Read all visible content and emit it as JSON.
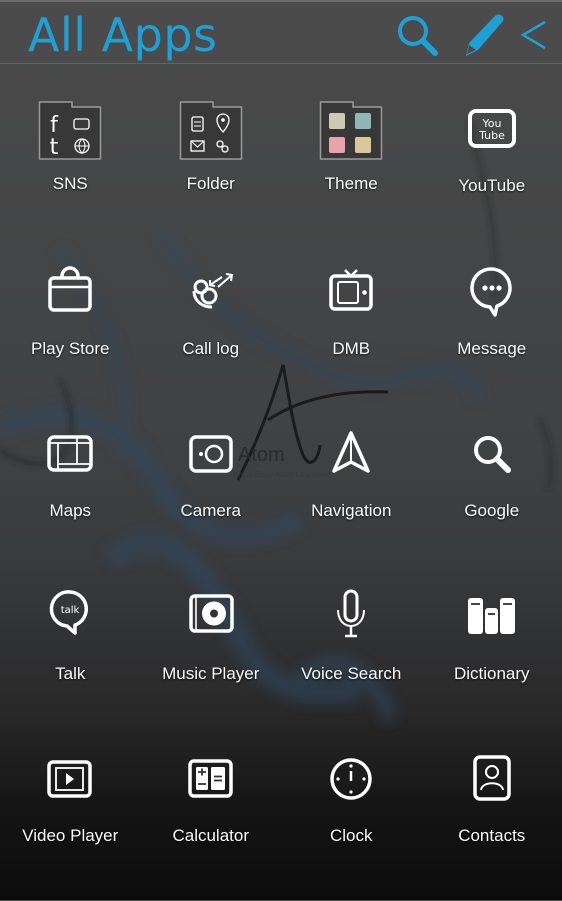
{
  "header": {
    "title": "All Apps",
    "accent_color": "#1ea0d6",
    "actions": [
      {
        "name": "search",
        "icon": "search-icon"
      },
      {
        "name": "edit",
        "icon": "pencil-icon"
      },
      {
        "name": "back",
        "icon": "chevron-left-icon"
      }
    ]
  },
  "watermark": {
    "brand": "Atom",
    "tagline": "Light & Easy Atom Launcher"
  },
  "apps": [
    {
      "label": "SNS",
      "icon": "sns-folder-icon"
    },
    {
      "label": "Folder",
      "icon": "folder-icon"
    },
    {
      "label": "Theme",
      "icon": "theme-folder-icon"
    },
    {
      "label": "YouTube",
      "icon": "youtube-icon"
    },
    {
      "label": "Play Store",
      "icon": "shopping-bag-icon"
    },
    {
      "label": "Call log",
      "icon": "call-log-icon"
    },
    {
      "label": "DMB",
      "icon": "tv-icon"
    },
    {
      "label": "Message",
      "icon": "message-bubble-icon"
    },
    {
      "label": "Maps",
      "icon": "map-grid-icon"
    },
    {
      "label": "Camera",
      "icon": "camera-icon"
    },
    {
      "label": "Navigation",
      "icon": "navigation-arrow-icon"
    },
    {
      "label": "Google",
      "icon": "search-icon"
    },
    {
      "label": "Talk",
      "icon": "talk-bubble-icon"
    },
    {
      "label": "Music Player",
      "icon": "music-disc-icon"
    },
    {
      "label": "Voice Search",
      "icon": "microphone-icon"
    },
    {
      "label": "Dictionary",
      "icon": "books-icon"
    },
    {
      "label": "Video Player",
      "icon": "video-play-icon"
    },
    {
      "label": "Calculator",
      "icon": "calculator-icon"
    },
    {
      "label": "Clock",
      "icon": "clock-icon"
    },
    {
      "label": "Contacts",
      "icon": "contact-card-icon"
    }
  ],
  "folder_contents": {
    "sns": [
      "f",
      "t"
    ],
    "youtube_text": [
      "You",
      "Tube"
    ],
    "talk_text": "talk"
  }
}
